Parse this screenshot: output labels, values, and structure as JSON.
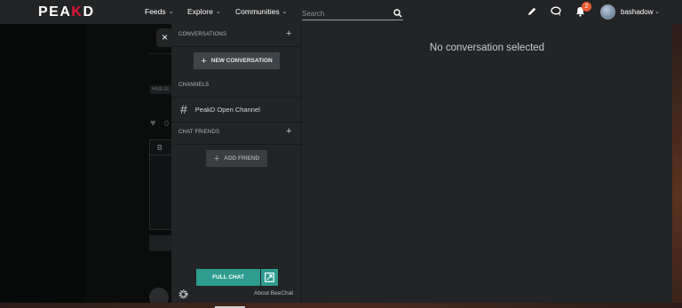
{
  "header": {
    "logo_main": "PEA",
    "logo_accent": "K",
    "logo_end": "D",
    "nav": [
      {
        "label": "Feeds"
      },
      {
        "label": "Explore"
      },
      {
        "label": "Communities"
      }
    ],
    "search_placeholder": "Search",
    "notification_count": "2",
    "username": "bashadow",
    "icons": [
      "pencil-icon",
      "chat-icon",
      "bell-icon",
      "search-icon"
    ]
  },
  "background": {
    "tag": "HIVE-16",
    "vote_count": "0",
    "bold_tool": "B"
  },
  "chat": {
    "close_symbol": "×",
    "conversations_heading": "CONVERSATIONS",
    "new_conversation_label": "NEW CONVERSATION",
    "channels_heading": "CHANNELS",
    "channels": [
      {
        "name": "PeakD Open Channel"
      }
    ],
    "chat_friends_heading": "CHAT FRIENDS",
    "add_friend_label": "ADD FRIEND",
    "full_chat_label": "FULL CHAT",
    "about_label": "About BeeChat",
    "empty_message": "No conversation selected"
  },
  "colors": {
    "accent_red": "#e31337",
    "teal": "#2e9c8f",
    "panel": "#222426",
    "badge": "#e8592f"
  }
}
